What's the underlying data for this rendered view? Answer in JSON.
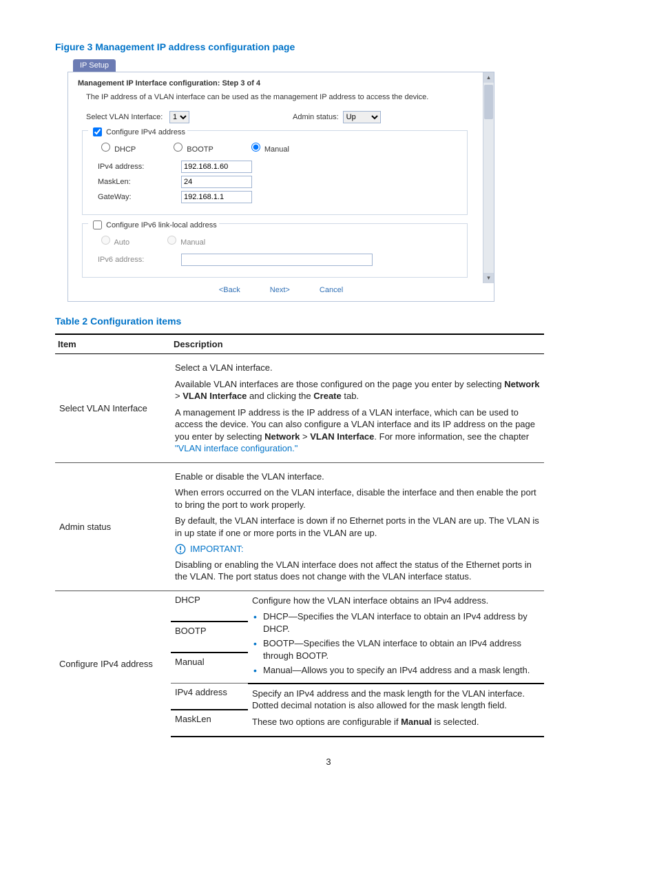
{
  "figure": {
    "caption": "Figure 3 Management IP address configuration page",
    "tab": "IP Setup",
    "panel_title": "Management IP Interface configuration:  Step 3 of 4",
    "panel_desc": "The IP address of a VLAN interface can be used as the management IP address to access the device.",
    "select_vlan_label": "Select VLAN Interface:",
    "select_vlan_value": "1",
    "admin_status_label": "Admin status:",
    "admin_status_value": "Up",
    "ipv4_group": {
      "legend": "Configure IPv4 address",
      "dhcp": "DHCP",
      "bootp": "BOOTP",
      "manual": "Manual",
      "ipv4_addr_label": "IPv4 address:",
      "ipv4_addr_value": "192.168.1.60",
      "masklen_label": "MaskLen:",
      "masklen_value": "24",
      "gateway_label": "GateWay:",
      "gateway_value": "192.168.1.1"
    },
    "ipv6_group": {
      "legend": "Configure IPv6 link-local address",
      "auto": "Auto",
      "manual": "Manual",
      "ipv6_addr_label": "IPv6 address:"
    },
    "buttons": {
      "back": "<Back",
      "next": "Next>",
      "cancel": "Cancel"
    }
  },
  "table_caption": "Table 2 Configuration items",
  "table": {
    "head_item": "Item",
    "head_desc": "Description",
    "rows": [
      {
        "item": "Select VLAN Interface",
        "desc": {
          "p1": "Select a VLAN interface.",
          "p2a": "Available VLAN interfaces are those configured on the page you enter by selecting ",
          "p2_b1": "Network",
          "p2_gt": " > ",
          "p2_b2": "VLAN Interface",
          "p2_tail": " and clicking the ",
          "p2_b3": "Create",
          "p2_end": " tab.",
          "p3a": "A management IP address is the IP address of a VLAN interface, which can be used to access the device. You can also configure a VLAN interface and its IP address on the page you enter by selecting ",
          "p3_b1": "Network",
          "p3_gt": " > ",
          "p3_b2": "VLAN Interface",
          "p3_tail": ". For more information, see the chapter ",
          "p3_link": "\"VLAN interface configuration.\""
        }
      },
      {
        "item": "Admin status",
        "desc": {
          "p1": "Enable or disable the VLAN interface.",
          "p2": "When errors occurred on the VLAN interface, disable the interface and then enable the port to bring the port to work properly.",
          "p3": "By default, the VLAN interface is down if no Ethernet ports in the VLAN are up. The VLAN is in up state if one or more ports in the VLAN are up.",
          "important": "IMPORTANT:",
          "p4": "Disabling or enabling the VLAN interface does not affect the status of the Ethernet ports in the VLAN. The port status does not change with the VLAN interface status."
        }
      },
      {
        "item": "Configure IPv4 address",
        "modes": {
          "dhcp": "DHCP",
          "bootp": "BOOTP",
          "manual": "Manual",
          "ipv4_addr": "IPv4 address",
          "masklen": "MaskLen"
        },
        "modes_desc": {
          "intro": "Configure how the VLAN interface obtains an IPv4 address.",
          "li_dhcp": "DHCP—Specifies the VLAN interface to obtain an IPv4 address by DHCP.",
          "li_bootp": "BOOTP—Specifies the VLAN interface to obtain an IPv4 address through BOOTP.",
          "li_manual": "Manual—Allows you to specify an IPv4 address and a mask length.",
          "p1": "Specify an IPv4 address and the mask length for the VLAN interface. Dotted decimal notation is also allowed for the mask length field.",
          "p2a": "These two options are configurable if ",
          "p2_b": "Manual",
          "p2_tail": " is selected."
        }
      }
    ]
  },
  "page_number": "3"
}
